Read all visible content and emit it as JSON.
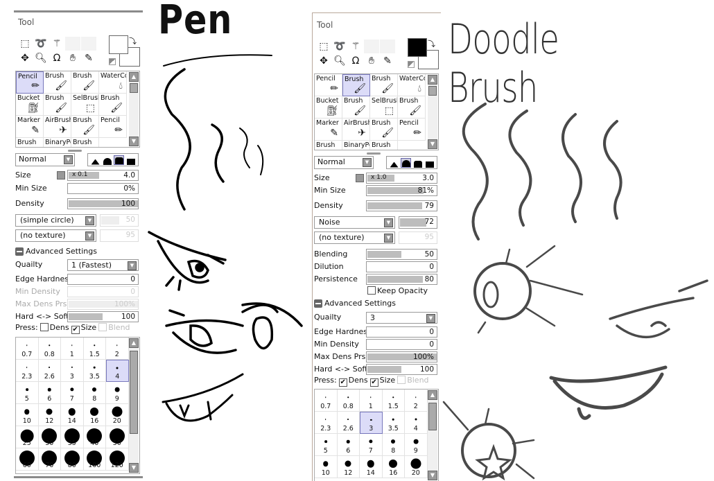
{
  "drawings": {
    "left_title": "Pen",
    "right_title": "Doodle Brush"
  },
  "left_panel": {
    "title": "Tool",
    "foreground_color": "#ffffff",
    "background_color": "#ffffff",
    "tool_icons": [
      "rect-select-icon",
      "lasso-icon",
      "magic-wand-icon",
      "",
      "",
      "move-icon",
      "zoom-icon",
      "rotate-icon",
      "hand-icon",
      "eyedropper-icon"
    ],
    "brushes": [
      {
        "label": "Pencil",
        "icon": "pencil-icon"
      },
      {
        "label": "Brush",
        "icon": "brush-icon"
      },
      {
        "label": "Brush",
        "icon": "brush-icon"
      },
      {
        "label": "WaterCo",
        "icon": "watercolor-icon"
      },
      {
        "label": "Bucket",
        "icon": "bucket-icon"
      },
      {
        "label": "Brush",
        "icon": "brush-icon"
      },
      {
        "label": "SelBrush",
        "icon": "selbrush-icon"
      },
      {
        "label": "Brush",
        "icon": "brush-icon"
      },
      {
        "label": "Marker",
        "icon": "marker-icon"
      },
      {
        "label": "AirBrush",
        "icon": "airbrush-icon"
      },
      {
        "label": "Brush",
        "icon": "brush-icon"
      },
      {
        "label": "Pencil",
        "icon": "pencil-icon"
      },
      {
        "label": "Brush",
        "icon": "brush-icon"
      },
      {
        "label": "BinaryPe",
        "icon": "binary-pen-icon"
      },
      {
        "label": "Brush",
        "icon": "brush-icon"
      }
    ],
    "selected_brush": 0,
    "blend_mode": "Normal",
    "selected_shape": 2,
    "rows": [
      {
        "type": "slider",
        "label": "Size",
        "multiplier": "x 0.1",
        "value": "4.0",
        "fill": 0.45
      },
      {
        "type": "slider",
        "label": "Min Size",
        "value": "0%",
        "fill": 0
      },
      {
        "type": "slider",
        "label": "Density",
        "value": "100",
        "fill": 1
      },
      {
        "type": "select_slider",
        "select": "(simple circle)",
        "value": "50",
        "fill": 0.5,
        "disabled": true
      },
      {
        "type": "select_slider",
        "select": "(no texture)",
        "value": "95",
        "fill": 0,
        "disabled": true
      },
      {
        "type": "section",
        "label": "Advanced Settings"
      },
      {
        "type": "select",
        "label": "Quailty",
        "select": "1 (Fastest)"
      },
      {
        "type": "slider",
        "label": "Edge Hardness",
        "value": "0",
        "fill": 0
      },
      {
        "type": "slider",
        "label": "Min Density",
        "value": "0",
        "fill": 0,
        "disabled": true
      },
      {
        "type": "slider",
        "label": "Max Dens Prs.",
        "value": "100%",
        "fill": 1,
        "disabled": true
      },
      {
        "type": "slider",
        "label": "Hard <-> Soft",
        "value": "100",
        "fill": 0.5
      },
      {
        "type": "press",
        "label": "Press:",
        "options": [
          {
            "label": "Dens",
            "checked": false,
            "enabled": true
          },
          {
            "label": "Size",
            "checked": true,
            "enabled": true
          },
          {
            "label": "Blend",
            "checked": false,
            "enabled": false
          }
        ]
      }
    ],
    "sizes": [
      "0.7",
      "0.8",
      "1",
      "1.5",
      "2",
      "2.3",
      "2.6",
      "3",
      "3.5",
      "4",
      "5",
      "6",
      "7",
      "8",
      "9",
      "10",
      "12",
      "14",
      "16",
      "20",
      "25",
      "30",
      "35",
      "40",
      "50",
      "60",
      "70",
      "80",
      "100",
      "120"
    ],
    "selected_size": "4"
  },
  "right_panel": {
    "title": "Tool",
    "foreground_color": "#000000",
    "background_color": "#ffffff",
    "tool_icons": [
      "rect-select-icon",
      "lasso-icon",
      "magic-wand-icon",
      "",
      "",
      "move-icon",
      "zoom-icon",
      "rotate-icon",
      "hand-icon",
      "eyedropper-icon"
    ],
    "brushes": [
      {
        "label": "Pencil",
        "icon": "pencil-icon"
      },
      {
        "label": "Brush",
        "icon": "brush-icon"
      },
      {
        "label": "Brush",
        "icon": "brush-icon"
      },
      {
        "label": "WaterCo",
        "icon": "watercolor-icon"
      },
      {
        "label": "Bucket",
        "icon": "bucket-icon"
      },
      {
        "label": "Brush",
        "icon": "brush-icon"
      },
      {
        "label": "SelBrush",
        "icon": "selbrush-icon"
      },
      {
        "label": "Brush",
        "icon": "brush-icon"
      },
      {
        "label": "Marker",
        "icon": "marker-icon"
      },
      {
        "label": "AirBrush",
        "icon": "airbrush-icon"
      },
      {
        "label": "Brush",
        "icon": "brush-icon"
      },
      {
        "label": "Pencil",
        "icon": "pencil-icon"
      },
      {
        "label": "Brush",
        "icon": "brush-icon"
      },
      {
        "label": "BinaryPe",
        "icon": "binary-pen-icon"
      },
      {
        "label": "Brush",
        "icon": "brush-icon"
      }
    ],
    "selected_brush": 1,
    "blend_mode": "Normal",
    "selected_shape": 1,
    "rows": [
      {
        "type": "slider",
        "label": "Size",
        "multiplier": "x 1.0",
        "value": "3.0",
        "fill": 0.4
      },
      {
        "type": "slider",
        "label": "Min Size",
        "value": "81%",
        "fill": 0.81
      },
      {
        "type": "slider",
        "label": "Density",
        "value": "79",
        "fill": 0.79
      },
      {
        "type": "select_slider",
        "select": "Noise",
        "value": "72",
        "fill": 0.72
      },
      {
        "type": "select_slider",
        "select": "(no texture)",
        "value": "95",
        "fill": 0,
        "disabled": true
      },
      {
        "type": "slider",
        "label": "Blending",
        "value": "50",
        "fill": 0.5
      },
      {
        "type": "slider",
        "label": "Dilution",
        "value": "0",
        "fill": 0
      },
      {
        "type": "slider",
        "label": "Persistence",
        "value": "80",
        "fill": 0.8
      },
      {
        "type": "checkbox",
        "label": "Keep Opacity",
        "checked": false
      },
      {
        "type": "section",
        "label": "Advanced Settings"
      },
      {
        "type": "select",
        "label": "Quailty",
        "select": "3"
      },
      {
        "type": "slider",
        "label": "Edge Hardness",
        "value": "0",
        "fill": 0
      },
      {
        "type": "slider",
        "label": "Min Density",
        "value": "0",
        "fill": 0
      },
      {
        "type": "slider",
        "label": "Max Dens Prs.",
        "value": "100%",
        "fill": 1
      },
      {
        "type": "slider",
        "label": "Hard <-> Soft",
        "value": "100",
        "fill": 0.5
      },
      {
        "type": "press",
        "label": "Press:",
        "options": [
          {
            "label": "Dens",
            "checked": true,
            "enabled": true
          },
          {
            "label": "Size",
            "checked": true,
            "enabled": true
          },
          {
            "label": "Blend",
            "checked": false,
            "enabled": false
          }
        ]
      }
    ],
    "sizes": [
      "0.7",
      "0.8",
      "1",
      "1.5",
      "2",
      "2.3",
      "2.6",
      "3",
      "3.5",
      "4",
      "5",
      "6",
      "7",
      "8",
      "9",
      "10",
      "12",
      "14",
      "16",
      "20"
    ],
    "selected_size": "3"
  }
}
